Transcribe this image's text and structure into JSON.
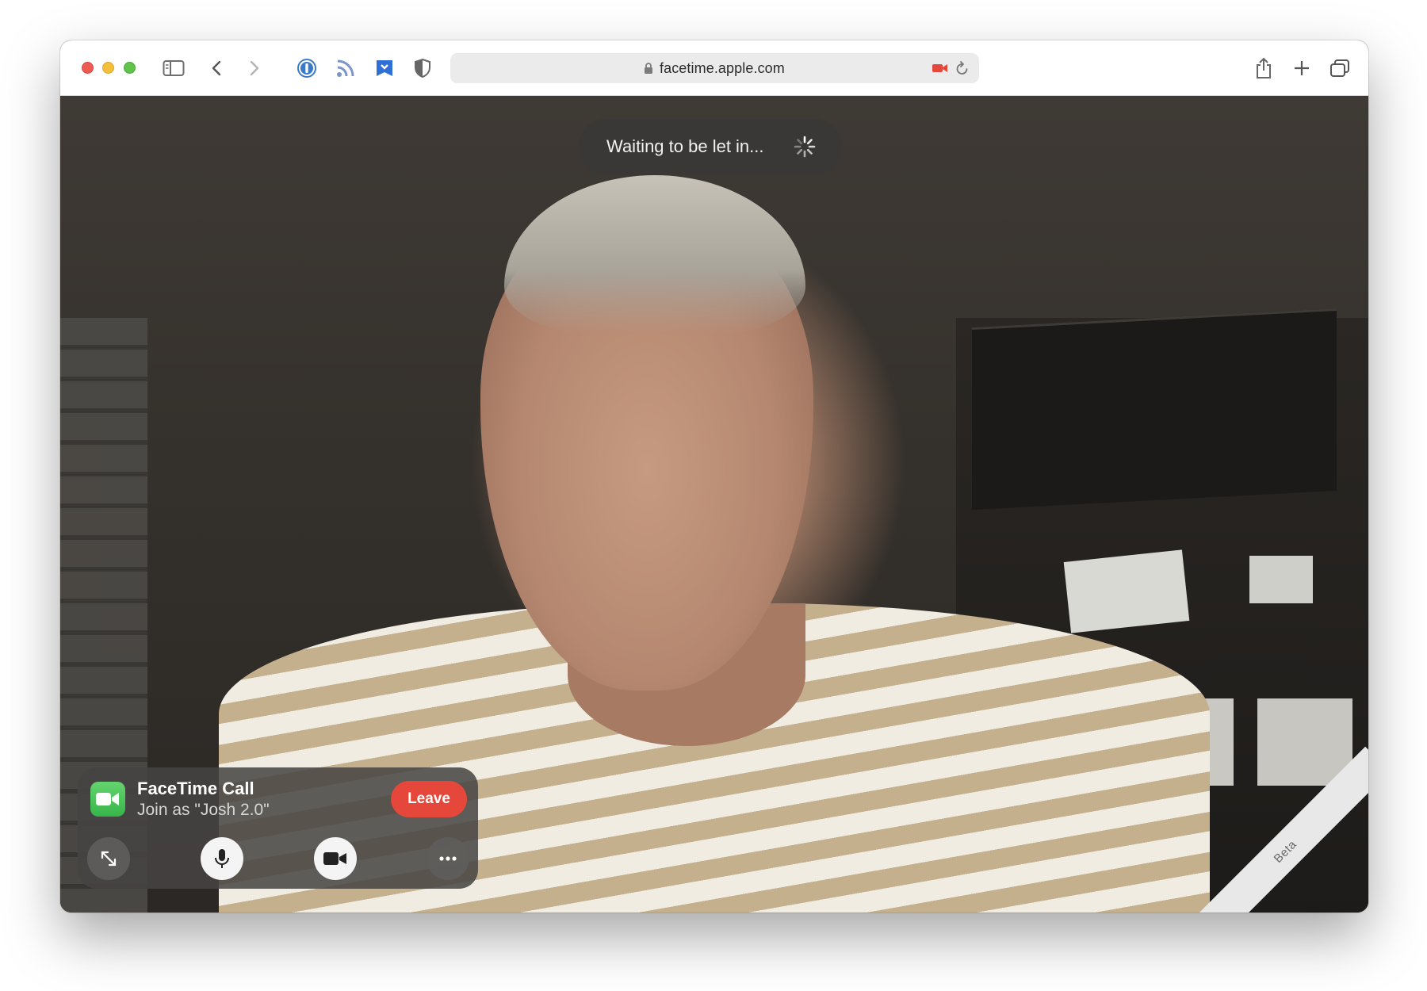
{
  "browser": {
    "address_url": "facetime.apple.com",
    "icons": [
      "sidebar-icon",
      "back-icon",
      "forward-icon",
      "1password-icon",
      "rss-icon",
      "bookmark-shield-icon",
      "privacy-shield-icon",
      "lock-icon",
      "camera-recording-icon",
      "reload-icon",
      "share-icon",
      "new-tab-icon",
      "tabs-overview-icon"
    ],
    "camera_indicator_color": "#e5483b"
  },
  "status": {
    "waiting_text": "Waiting to be let in..."
  },
  "call_panel": {
    "title": "FaceTime Call",
    "subtitle": "Join as \"Josh 2.0\"",
    "leave_label": "Leave",
    "leave_color": "#e5483b",
    "controls": [
      "fullscreen-icon",
      "microphone-icon",
      "video-camera-icon",
      "more-icon"
    ]
  },
  "ribbon": {
    "label": "Beta"
  }
}
